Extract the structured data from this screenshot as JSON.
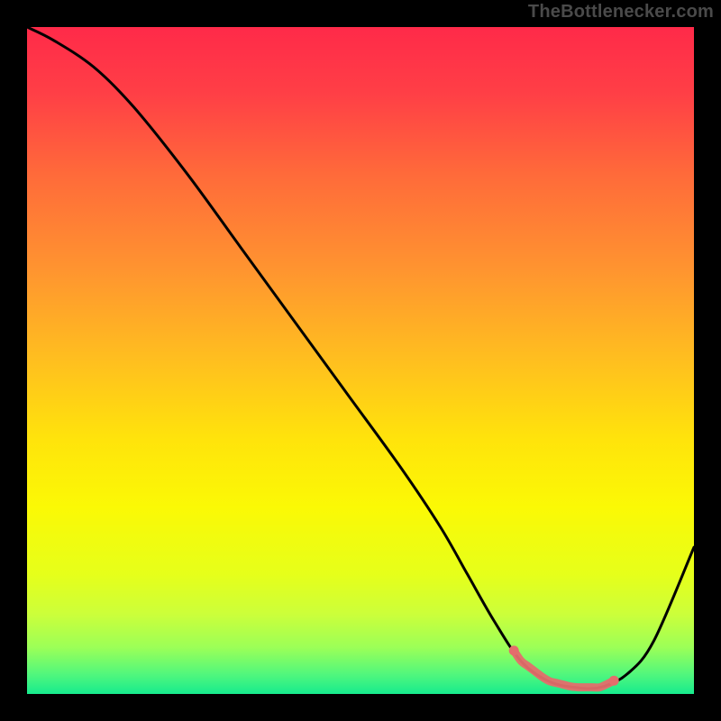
{
  "watermark": "TheBottlenecker.com",
  "chart_data": {
    "type": "line",
    "title": "",
    "xlabel": "",
    "ylabel": "",
    "xlim": [
      0,
      100
    ],
    "ylim": [
      0,
      100
    ],
    "x": [
      0,
      4,
      10,
      16,
      24,
      32,
      40,
      48,
      56,
      62,
      66,
      70,
      74,
      78,
      82,
      86,
      90,
      94,
      100
    ],
    "values": [
      100,
      98,
      94,
      88,
      78,
      67,
      56,
      45,
      34,
      25,
      18,
      11,
      5,
      2,
      1,
      1,
      3,
      8,
      22
    ],
    "highlight_range_x": [
      73,
      88
    ],
    "gradient_stops": [
      {
        "offset": 0.0,
        "color": "#ff2a49"
      },
      {
        "offset": 0.1,
        "color": "#ff3f46"
      },
      {
        "offset": 0.22,
        "color": "#ff6a3a"
      },
      {
        "offset": 0.36,
        "color": "#ff9330"
      },
      {
        "offset": 0.5,
        "color": "#ffbf1f"
      },
      {
        "offset": 0.62,
        "color": "#ffe40b"
      },
      {
        "offset": 0.72,
        "color": "#fbf905"
      },
      {
        "offset": 0.82,
        "color": "#e6ff1a"
      },
      {
        "offset": 0.88,
        "color": "#ccff3a"
      },
      {
        "offset": 0.93,
        "color": "#9cff57"
      },
      {
        "offset": 0.97,
        "color": "#52f77c"
      },
      {
        "offset": 1.0,
        "color": "#17eb8e"
      }
    ],
    "curve_color": "#000000",
    "highlight_color": "#e46d6c",
    "outer_bg": "#000000"
  }
}
